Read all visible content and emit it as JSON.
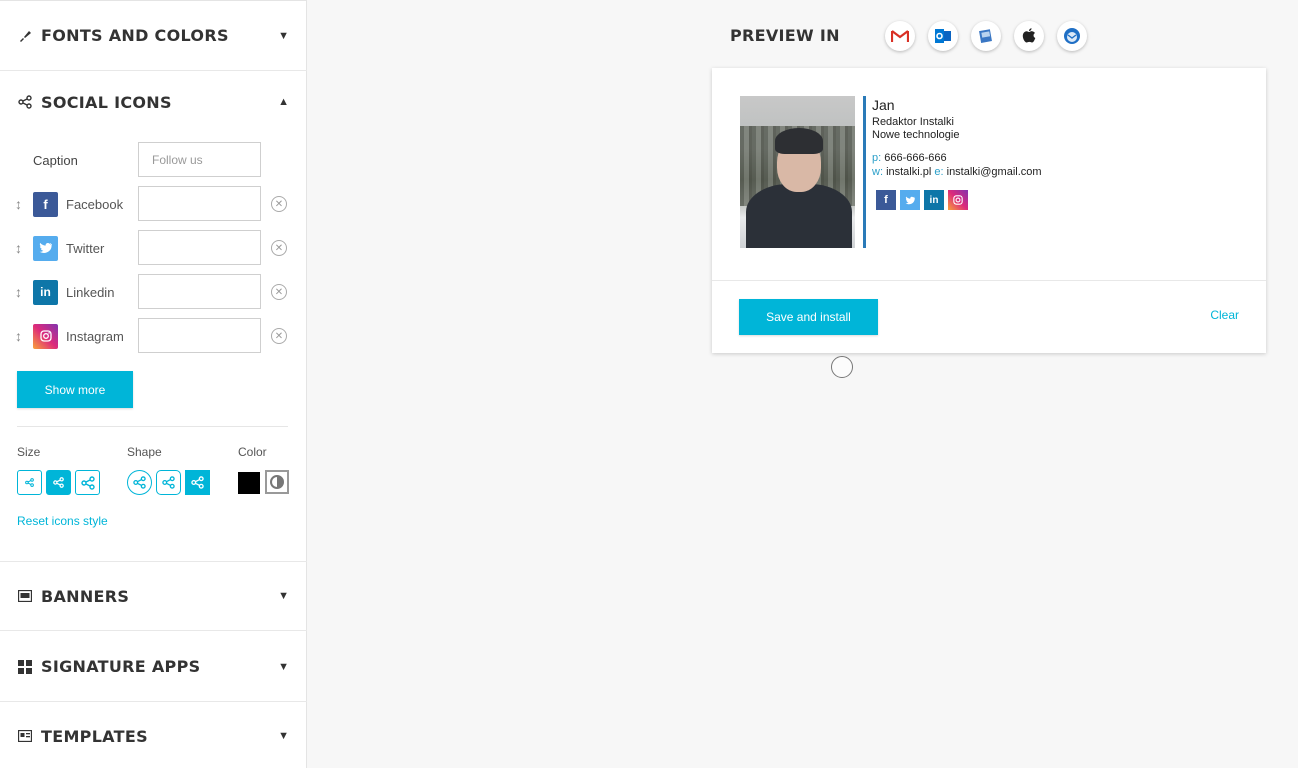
{
  "sidebar": {
    "fonts_and_colors": "FONTS AND COLORS",
    "social_icons": "SOCIAL ICONS",
    "banners": "BANNERS",
    "signature_apps": "SIGNATURE APPS",
    "templates": "TEMPLATES",
    "arrow_down": "▼",
    "arrow_up": "▲"
  },
  "social": {
    "caption_label": "Caption",
    "caption_placeholder": "Follow us",
    "networks": [
      {
        "label": "Facebook",
        "glyph": "f",
        "color": "#3b5998",
        "icon": "facebook-icon"
      },
      {
        "label": "Twitter",
        "glyph": "t",
        "color": "#55acee",
        "icon": "twitter-icon"
      },
      {
        "label": "Linkedin",
        "glyph": "in",
        "color": "#0e76a8",
        "icon": "linkedin-icon"
      },
      {
        "label": "Instagram",
        "glyph": "◎",
        "color": "#dd2a7b",
        "icon": "instagram-icon"
      }
    ],
    "show_more": "Show more",
    "size_label": "Size",
    "shape_label": "Shape",
    "color_label": "Color",
    "reset_link": "Reset icons style"
  },
  "preview": {
    "title": "PREVIEW IN",
    "clients": [
      "gmail-icon",
      "outlook-icon",
      "office365-icon",
      "apple-mail-icon",
      "thunderbird-icon"
    ]
  },
  "signature": {
    "name": "Jan",
    "job_title": "Redaktor Instalki",
    "department": "Nowe technologie",
    "phone_key": "p:",
    "phone": "666-666-666",
    "web_key": "w:",
    "web": "instalki.pl",
    "email_key": "e:",
    "email": "instalki@gmail.com"
  },
  "actions": {
    "save_install": "Save and install",
    "clear": "Clear"
  },
  "colors": {
    "accent": "#00b5d8",
    "divider_line": "#2a7ab8",
    "color_swatch_black": "#000000"
  }
}
